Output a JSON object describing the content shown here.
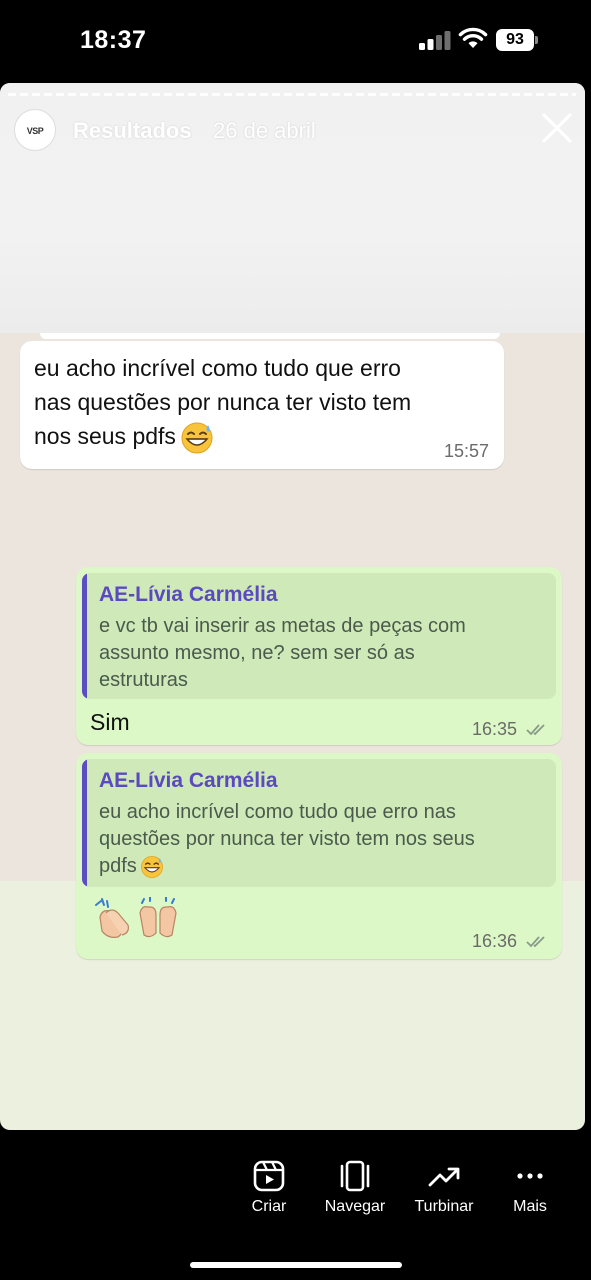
{
  "status_bar": {
    "time": "18:37",
    "battery": "93",
    "icons": [
      "cellular-signal-icon",
      "wifi-icon",
      "battery-icon"
    ]
  },
  "story": {
    "avatar_text": "VSP",
    "account_name": "Resultados",
    "date": "26 de abril",
    "close_icon": "close-icon"
  },
  "chat": {
    "messages": [
      {
        "direction": "incoming",
        "lines": [
          "eu acho incrível como tudo que erro",
          "nas questões por nunca ter visto tem",
          "nos seus pdfs"
        ],
        "emoji": "grinning-sweat-emoji",
        "time": "15:57"
      },
      {
        "direction": "outgoing",
        "quote_author": "AE-Lívia Carmélia",
        "quote_lines": [
          "e vc tb vai inserir as metas de peças com",
          "assunto mesmo, ne? sem ser só as",
          "estruturas"
        ],
        "text": "Sim",
        "time": "16:35",
        "status": "read"
      },
      {
        "direction": "outgoing",
        "quote_author": "AE-Lívia Carmélia",
        "quote_lines": [
          "eu acho incrível como tudo que erro nas",
          "questões por nunca ter visto tem nos seus",
          "pdfs"
        ],
        "quote_emoji": "grinning-sweat-emoji",
        "emojis": [
          "clapping-hands-emoji",
          "raising-hands-emoji"
        ],
        "time": "16:36",
        "status": "read"
      }
    ]
  },
  "bottom_bar": {
    "actions": [
      {
        "label": "Criar",
        "icon": "reels-icon"
      },
      {
        "label": "Navegar",
        "icon": "carousel-icon"
      },
      {
        "label": "Turbinar",
        "icon": "trending-up-icon"
      },
      {
        "label": "Mais",
        "icon": "more-dots-icon"
      }
    ]
  },
  "colors": {
    "incoming_bubble": "#ffffff",
    "outgoing_bubble": "#dcf8c6",
    "quote_name": "#5b49c0",
    "quote_bar": "#5c4dc2",
    "chat_background": "#ece5dd",
    "story_background": "#ebf1de"
  }
}
